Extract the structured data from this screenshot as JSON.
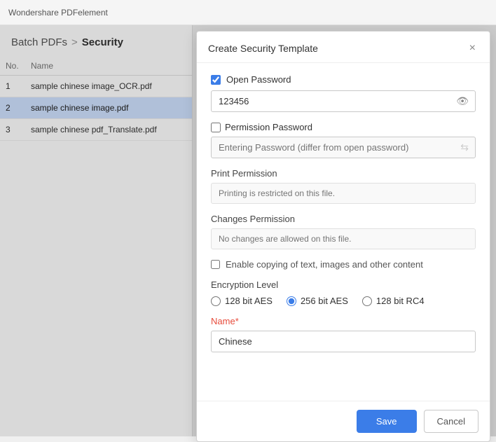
{
  "titlebar": {
    "text": "Wondershare PDFelement"
  },
  "breadcrumb": {
    "batch": "Batch PDFs",
    "separator": ">",
    "current": "Security"
  },
  "table": {
    "columns": [
      "No.",
      "Name"
    ],
    "rows": [
      {
        "no": "1",
        "name": "sample chinese image_OCR.pdf",
        "selected": false
      },
      {
        "no": "2",
        "name": "sample chinese image.pdf",
        "selected": true
      },
      {
        "no": "3",
        "name": "sample chinese pdf_Translate.pdf",
        "selected": false
      }
    ]
  },
  "modal": {
    "title": "Create Security Template",
    "close_icon": "×",
    "open_password": {
      "label": "Open Password",
      "checked": true,
      "value": "123456",
      "eye_icon": "👁"
    },
    "permission_password": {
      "label": "Permission Password",
      "checked": false,
      "placeholder": "Entering Password (differ from open password)",
      "icon": "↔"
    },
    "print_permission": {
      "label": "Print Permission",
      "placeholder": "Printing is restricted on this file."
    },
    "changes_permission": {
      "label": "Changes Permission",
      "placeholder": "No changes are allowed on this file."
    },
    "enable_copying": {
      "label": "Enable copying of text, images and other content",
      "checked": false
    },
    "encryption_level": {
      "label": "Encryption Level",
      "options": [
        {
          "label": "128 bit AES",
          "value": "128aes",
          "selected": false
        },
        {
          "label": "256 bit AES",
          "value": "256aes",
          "selected": true
        },
        {
          "label": "128 bit RC4",
          "value": "128rc4",
          "selected": false
        }
      ]
    },
    "name": {
      "label": "Name",
      "required": true,
      "required_mark": "*",
      "value": "Chinese"
    },
    "footer": {
      "save_label": "Save",
      "cancel_label": "Cancel"
    }
  }
}
